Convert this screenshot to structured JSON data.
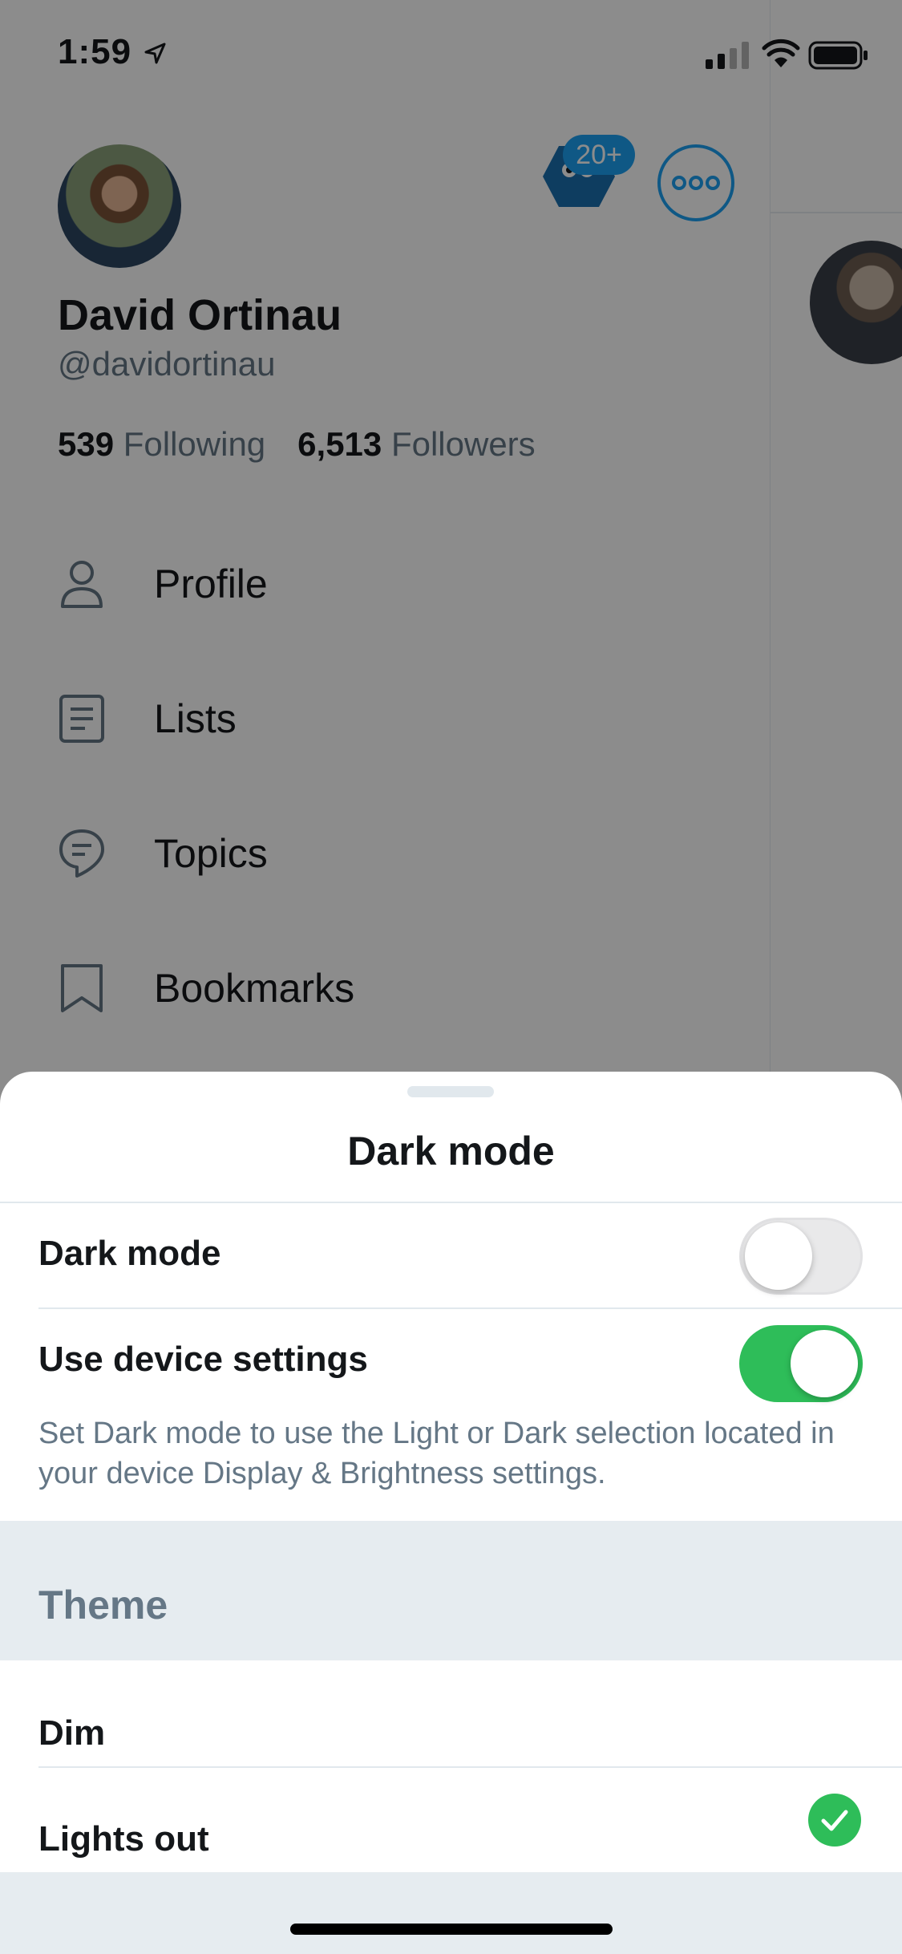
{
  "status_bar": {
    "time": "1:59"
  },
  "drawer": {
    "user": {
      "name": "David Ortinau",
      "handle": "@davidortinau"
    },
    "notification_count": "20+",
    "stats": {
      "following_count": "539",
      "following_label": "Following",
      "followers_count": "6,513",
      "followers_label": "Followers"
    },
    "menu": [
      {
        "label": "Profile",
        "icon": "person-icon"
      },
      {
        "label": "Lists",
        "icon": "list-icon"
      },
      {
        "label": "Topics",
        "icon": "topic-bubble-icon"
      },
      {
        "label": "Bookmarks",
        "icon": "bookmark-icon"
      }
    ]
  },
  "sheet": {
    "title": "Dark mode",
    "dark_mode": {
      "label": "Dark mode",
      "enabled": false
    },
    "device_settings": {
      "label": "Use device settings",
      "enabled": true,
      "description": "Set Dark mode to use the Light or Dark selection located in your device Display & Brightness settings."
    },
    "theme": {
      "heading": "Theme",
      "options": [
        {
          "label": "Dim",
          "selected": false
        },
        {
          "label": "Lights out",
          "selected": true
        }
      ]
    }
  },
  "colors": {
    "accent": "#1da1f2",
    "switch_on": "#2ebd59",
    "secondary_text": "#657786",
    "section_background": "#e6ecf0"
  }
}
